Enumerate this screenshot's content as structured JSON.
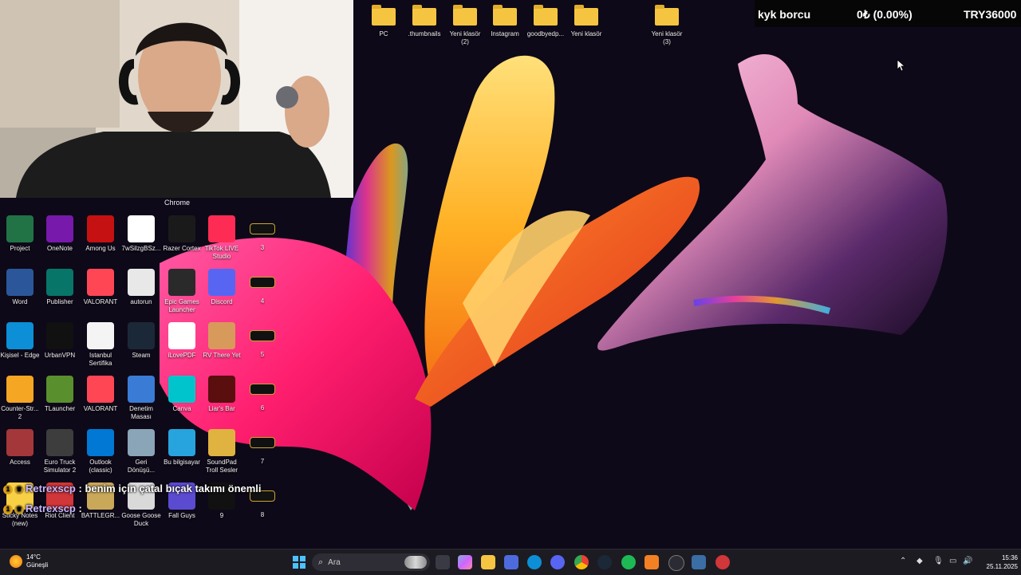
{
  "ticker": {
    "label": "kyk borcu",
    "change": "0₺ (0.00%)",
    "amount": "TRY36000"
  },
  "top_folders": [
    "PC",
    ".thumbnails",
    "Yeni klasör\n(2)",
    "Instagram",
    "goodbyedp...",
    "Yeni klasör",
    "Yeni klasör\n(3)"
  ],
  "chrome_label": "Chrome",
  "desktop_icons": [
    [
      "Project",
      "OneNote",
      "Among Us",
      "7wSilzgBSz...",
      "Razer Cortex",
      "TikTok LIVE\nStudio",
      "3"
    ],
    [
      "Word",
      "Publisher",
      "VALORANT",
      "autorun",
      "Epic Games\nLauncher",
      "Discord",
      "4"
    ],
    [
      "Kişisel - Edge",
      "UrbanVPN",
      "Istanbul\nSertifika",
      "Steam",
      "iLovePDF",
      "RV There Yet",
      "5"
    ],
    [
      "Counter-Str...\n2",
      "TLauncher",
      "VALORANT",
      "Denetim\nMasası",
      "Canva",
      "Liar's Bar",
      "6"
    ],
    [
      "Access",
      "Euro Truck\nSimulator 2",
      "Outlook\n(classic)",
      "Geri\nDönüşü...",
      "Bu bilgisayar",
      "SoundPad\nTroll Sesler",
      "7"
    ],
    [
      "Sticky Notes\n(new)",
      "Riot Client",
      "BATTLEGR...",
      "Goose Goose\nDuck",
      "Fall Guys",
      "9",
      "8"
    ]
  ],
  "icon_colors": {
    "Project": "#217346",
    "OneNote": "#7719aa",
    "Among Us": "#c51111",
    "7wSilzgBSz...": "#ffffff",
    "Razer Cortex": "#1a1a1a",
    "TikTok LIVE\nStudio": "#fe2c55",
    "3": "#111111",
    "Word": "#2b579a",
    "Publisher": "#077568",
    "VALORANT": "#ff4655",
    "autorun": "#e8e8e8",
    "Epic Games\nLauncher": "#2a2a2a",
    "Discord": "#5865f2",
    "4": "#111111",
    "Kişisel - Edge": "#0c8fd6",
    "UrbanVPN": "#111111",
    "Istanbul\nSertifika": "#f4f4f4",
    "Steam": "#1b2838",
    "iLovePDF": "#ffffff",
    "RV There Yet": "#d89a5b",
    "5": "#111111",
    "Counter-Str...\n2": "#f5a623",
    "TLauncher": "#5a8f2e",
    "Denetim\nMasası": "#3a7bd5",
    "Canva": "#00c4cc",
    "Liar's Bar": "#5a0e0e",
    "6": "#111111",
    "Access": "#a4373a",
    "Euro Truck\nSimulator 2": "#3d3d3d",
    "Outlook\n(classic)": "#0078d4",
    "Geri\nDönüşü...": "#8aa4b8",
    "Bu bilgisayar": "#27a4dd",
    "SoundPad\nTroll Sesler": "#e0b240",
    "7": "#111111",
    "Sticky Notes\n(new)": "#f7d046",
    "Riot Client": "#d13639",
    "BATTLEGR...": "#c9a85a",
    "Goose Goose\nDuck": "#d9d9d9",
    "Fall Guys": "#5b4bd1",
    "9": "#111111",
    "8": "#111111"
  },
  "chat": [
    {
      "user": "Retrexscp",
      "message": ": benim için çatal bıçak takımı önemli"
    },
    {
      "user": "Retrexscp",
      "message": ":"
    }
  ],
  "taskbar": {
    "weather_temp": "14°C",
    "weather_desc": "Güneşli",
    "search_placeholder": "Ara",
    "time": "15:36",
    "date": "25.11.2025"
  }
}
